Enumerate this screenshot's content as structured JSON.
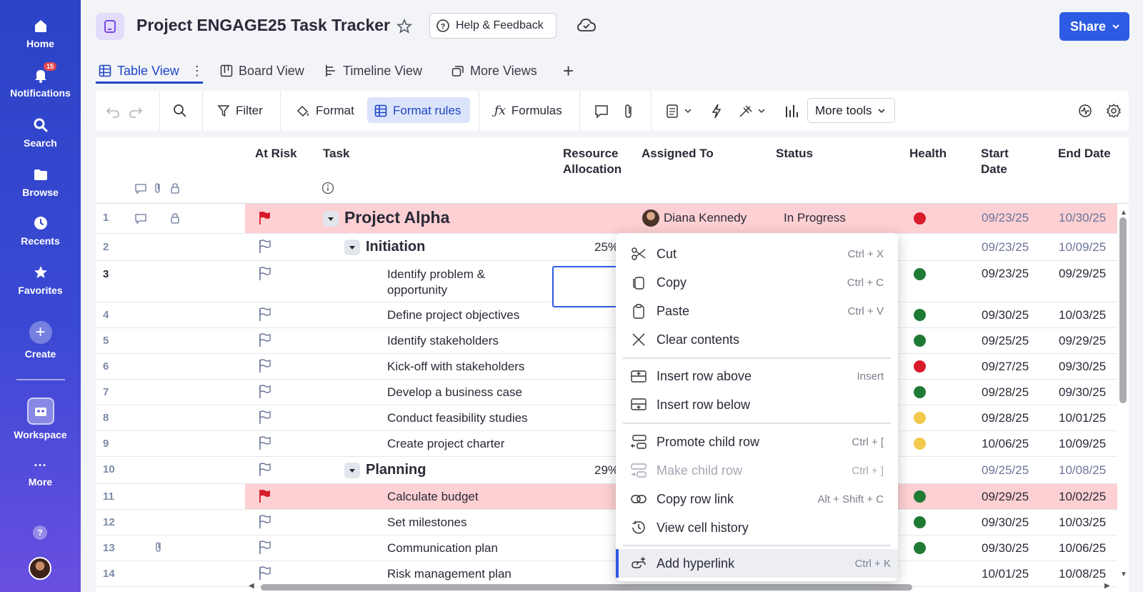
{
  "sidebar": {
    "home": "Home",
    "notifications": "Notifications",
    "notif_count": "15",
    "search": "Search",
    "browse": "Browse",
    "recents": "Recents",
    "favorites": "Favorites",
    "create": "Create",
    "workspace": "Workspace",
    "more": "More",
    "help": "?"
  },
  "header": {
    "title": "Project ENGAGE25 Task Tracker",
    "help_feedback": "Help & Feedback",
    "share": "Share"
  },
  "tabs": [
    "Table View",
    "Board View",
    "Timeline View",
    "More Views"
  ],
  "toolbar": {
    "filter": "Filter",
    "format": "Format",
    "format_rules": "Format rules",
    "formulas": "Formulas",
    "more_tools": "More tools"
  },
  "columns": {
    "at_risk": "At Risk",
    "task": "Task",
    "resource_1": "Resource",
    "resource_2": "Allocation",
    "assigned_to": "Assigned To",
    "status": "Status",
    "health": "Health",
    "start_1": "Start",
    "start_2": "Date",
    "end_date": "End Date"
  },
  "rows": [
    {
      "num": "1",
      "task": "Project Alpha",
      "assigned": "Diana Kennedy",
      "status": "In Progress",
      "health": "red",
      "start": "09/23/25",
      "end": "10/30/25",
      "at_risk": true
    },
    {
      "num": "2",
      "task": "Initiation",
      "alloc": "25%",
      "start": "09/23/25",
      "end": "10/09/25"
    },
    {
      "num": "3",
      "task_l1": "Identify problem &",
      "task_l2": "opportunity",
      "health": "green",
      "start": "09/23/25",
      "end": "09/29/25"
    },
    {
      "num": "4",
      "task": "Define project objectives",
      "health": "green",
      "start": "09/30/25",
      "end": "10/03/25"
    },
    {
      "num": "5",
      "task": "Identify stakeholders",
      "health": "green",
      "start": "09/25/25",
      "end": "09/29/25"
    },
    {
      "num": "6",
      "task": "Kick-off with stakeholders",
      "health": "red",
      "start": "09/27/25",
      "end": "09/30/25"
    },
    {
      "num": "7",
      "task": "Develop a business case",
      "health": "green",
      "start": "09/28/25",
      "end": "09/30/25"
    },
    {
      "num": "8",
      "task": "Conduct feasibility studies",
      "health": "yellow",
      "start": "09/28/25",
      "end": "10/01/25"
    },
    {
      "num": "9",
      "task": "Create project charter",
      "health": "yellow",
      "start": "10/06/25",
      "end": "10/09/25"
    },
    {
      "num": "10",
      "task": "Planning",
      "alloc": "29%",
      "start": "09/25/25",
      "end": "10/08/25"
    },
    {
      "num": "11",
      "task": "Calculate budget",
      "health": "green",
      "start": "09/29/25",
      "end": "10/02/25",
      "at_risk": true
    },
    {
      "num": "12",
      "task": "Set milestones",
      "health": "green",
      "start": "09/30/25",
      "end": "10/03/25"
    },
    {
      "num": "13",
      "task": "Communication plan",
      "health": "green",
      "start": "09/30/25",
      "end": "10/06/25"
    },
    {
      "num": "14",
      "task": "Risk management plan",
      "start": "10/01/25",
      "end": "10/08/25"
    }
  ],
  "context_menu": {
    "cut": "Cut",
    "cut_sc": "Ctrl + X",
    "copy": "Copy",
    "copy_sc": "Ctrl + C",
    "paste": "Paste",
    "paste_sc": "Ctrl + V",
    "clear": "Clear contents",
    "insert_above": "Insert row above",
    "insert_above_sc": "Insert",
    "insert_below": "Insert row below",
    "promote": "Promote child row",
    "promote_sc": "Ctrl + [",
    "make_child": "Make child row",
    "make_child_sc": "Ctrl + ]",
    "copy_link": "Copy row link",
    "copy_link_sc": "Alt + Shift + C",
    "history": "View cell history",
    "hyperlink": "Add hyperlink",
    "hyperlink_sc": "Ctrl + K"
  },
  "colors": {
    "accent": "#2d5be3",
    "risk_band": "#fdd0d3",
    "health_red": "#d81b2a",
    "health_green": "#1f7a34",
    "health_yellow": "#f2c94c"
  }
}
